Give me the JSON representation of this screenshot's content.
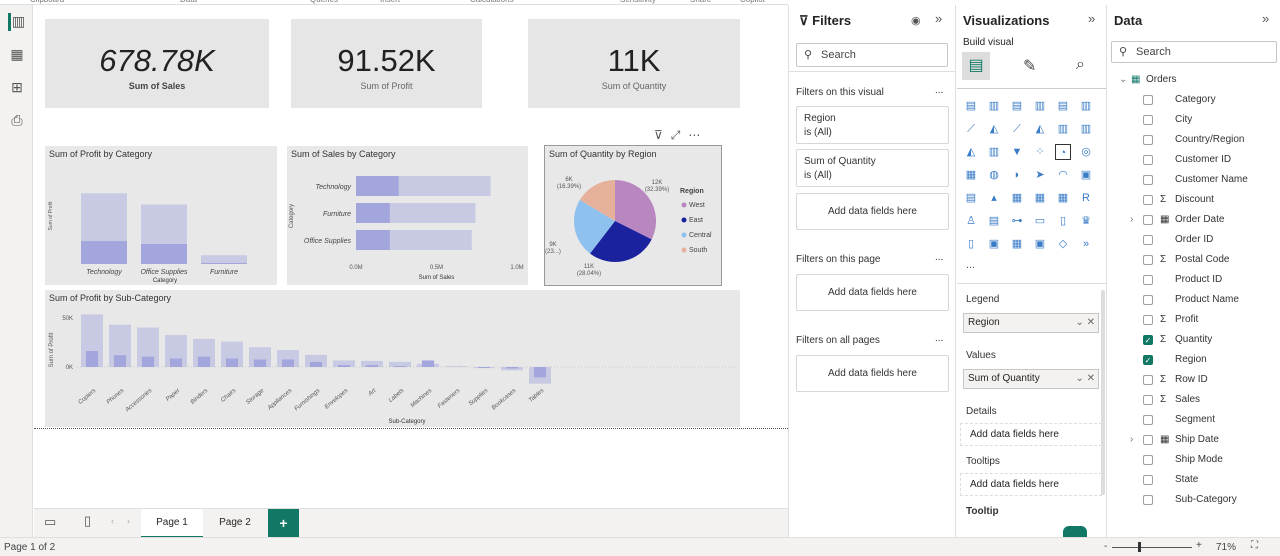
{
  "ribbon": {
    "groups": [
      "Clipboard",
      "Data",
      "Queries",
      "Insert",
      "Calculations",
      "Sensitivity",
      "Share",
      "Copilot"
    ]
  },
  "leftbar": {
    "icons": [
      "report-view-icon",
      "table-view-icon",
      "model-view-icon",
      "dax-query-icon"
    ]
  },
  "cards": [
    {
      "value": "678.78K",
      "label": "Sum of Sales"
    },
    {
      "value": "91.52K",
      "label": "Sum of Profit"
    },
    {
      "value": "11K",
      "label": "Sum of Quantity"
    }
  ],
  "chart_data": [
    {
      "type": "bar",
      "title": "Sum of Profit by Category",
      "xlabel": "Category",
      "ylabel": "Sum of Profit",
      "categories": [
        "Technology",
        "Office Supplies",
        "Furniture"
      ],
      "series": [
        {
          "values": [
            145000,
            122000,
            18000
          ]
        },
        {
          "values": [
            47000,
            41000,
            2000
          ]
        }
      ],
      "colors": [
        "#c8cae3",
        "#a3a6dc"
      ]
    },
    {
      "type": "bar",
      "orientation": "horizontal",
      "title": "Sum of Sales by Category",
      "xlabel": "Sum of Sales",
      "ylabel": "Category",
      "categories": [
        "Technology",
        "Furniture",
        "Office Supplies"
      ],
      "series": [
        {
          "values": [
            836000,
            742000,
            719000
          ]
        },
        {
          "values": [
            265000,
            210000,
            210000
          ]
        }
      ],
      "xlim": [
        0,
        1000000
      ],
      "xticks": [
        "0.0M",
        "0.5M",
        "1.0M"
      ],
      "colors": [
        "#c8cae3",
        "#a3a6dc"
      ]
    },
    {
      "type": "pie",
      "title": "Sum of Quantity by Region",
      "legend_title": "Region",
      "legend_position": "right",
      "slices": [
        {
          "name": "West",
          "value": 12266,
          "label": "12K",
          "pct": "(32.39%)",
          "color": "#b887c0"
        },
        {
          "name": "East",
          "value": 10618,
          "label": "11K",
          "pct": "(28.04%)",
          "color": "#1a229e"
        },
        {
          "name": "Central",
          "value": 8780,
          "label": "9K",
          "pct": "(23...)",
          "color": "#8fc1ee"
        },
        {
          "name": "South",
          "value": 6209,
          "label": "6K",
          "pct": "(16.39%)",
          "color": "#e6b19b"
        }
      ]
    },
    {
      "type": "bar",
      "title": "Sum of Profit by Sub-Category",
      "xlabel": "Sub-Category",
      "ylabel": "Sum of Profit",
      "yticks": [
        "50K",
        "0K"
      ],
      "categories": [
        "Copiers",
        "Phones",
        "Accessories",
        "Paper",
        "Binders",
        "Chairs",
        "Storage",
        "Appliances",
        "Furnishings",
        "Envelopes",
        "Art",
        "Labels",
        "Machines",
        "Fasteners",
        "Supplies",
        "Bookcases",
        "Tables"
      ],
      "series": [
        {
          "values": [
            56000,
            45000,
            42000,
            34000,
            30000,
            27000,
            21000,
            18000,
            13000,
            7000,
            6500,
            5500,
            3400,
            900,
            -1200,
            -3500,
            -17700
          ]
        },
        {
          "values": [
            17000,
            12500,
            11000,
            9000,
            11000,
            9000,
            8000,
            8000,
            5500,
            2000,
            2000,
            1000,
            7000,
            200,
            -1000,
            -1500,
            -11000
          ]
        }
      ],
      "ylim": [
        -20000,
        60000
      ],
      "colors": [
        "#c8cae3",
        "#a3a6dc"
      ]
    }
  ],
  "filters": {
    "title": "Filters",
    "search_placeholder": "Search",
    "on_visual": "Filters on this visual",
    "cards": [
      {
        "field": "Region",
        "cond": "is (All)"
      },
      {
        "field": "Sum of Quantity",
        "cond": "is (All)"
      }
    ],
    "add": "Add data fields here",
    "on_page": "Filters on this page",
    "on_all": "Filters on all pages",
    "more": "..."
  },
  "viz": {
    "title": "Visualizations",
    "build": "Build visual",
    "more": "...",
    "wells": {
      "legend_label": "Legend",
      "legend_value": "Region",
      "values_label": "Values",
      "values_value": "Sum of Quantity",
      "details_label": "Details",
      "tooltips_label": "Tooltips",
      "add": "Add data fields here",
      "tooltip_section": "Tooltip"
    }
  },
  "data": {
    "title": "Data",
    "search_placeholder": "Search",
    "table": "Orders",
    "fields": [
      {
        "name": "Category"
      },
      {
        "name": "City"
      },
      {
        "name": "Country/Region"
      },
      {
        "name": "Customer ID"
      },
      {
        "name": "Customer Name"
      },
      {
        "name": "Discount",
        "sigma": true
      },
      {
        "name": "Order Date",
        "date": true
      },
      {
        "name": "Order ID"
      },
      {
        "name": "Postal Code",
        "sigma": true
      },
      {
        "name": "Product ID"
      },
      {
        "name": "Product Name"
      },
      {
        "name": "Profit",
        "sigma": true
      },
      {
        "name": "Quantity",
        "sigma": true,
        "checked": true
      },
      {
        "name": "Region",
        "checked": true
      },
      {
        "name": "Row ID",
        "sigma": true
      },
      {
        "name": "Sales",
        "sigma": true
      },
      {
        "name": "Segment"
      },
      {
        "name": "Ship Date",
        "date": true
      },
      {
        "name": "Ship Mode"
      },
      {
        "name": "State"
      },
      {
        "name": "Sub-Category"
      }
    ]
  },
  "pages": {
    "tabs": [
      "Page 1",
      "Page 2"
    ],
    "active": "Page 1",
    "add": "+"
  },
  "status": {
    "page": "Page 1 of 2",
    "zoom": "71%"
  },
  "colors": {
    "accent": "#117865"
  }
}
